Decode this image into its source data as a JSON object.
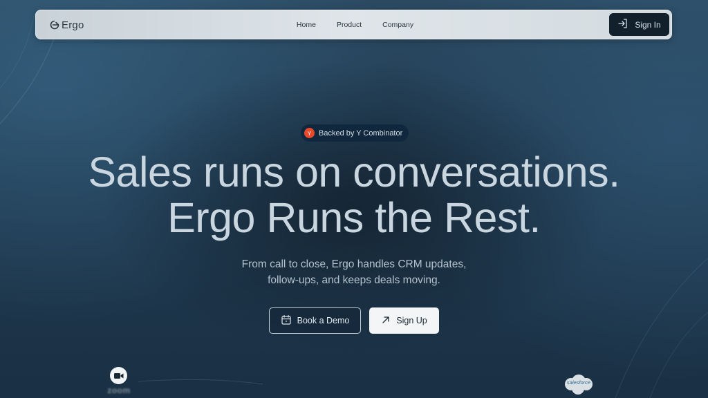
{
  "nav": {
    "logo_text": "Ergo",
    "links": [
      "Home",
      "Product",
      "Company"
    ],
    "signin_label": "Sign In"
  },
  "hero": {
    "badge": {
      "icon_letter": "Y",
      "text": "Backed by Y Combinator"
    },
    "headline_line1": "Sales runs on conversations.",
    "headline_line2": "Ergo Runs the Rest.",
    "subtitle_line1": "From call to close, Ergo handles CRM updates,",
    "subtitle_line2": "follow-ups, and keeps deals moving.",
    "demo_button": "Book a Demo",
    "signup_button": "Sign Up"
  },
  "integrations": {
    "zoom": "zoom",
    "salesforce": "salesforce"
  },
  "colors": {
    "background": "#1c3447",
    "nav_bg": "#dfe5e9",
    "signin_bg": "#12202c",
    "yc_orange": "#e8492a",
    "headline": "#c9d6df"
  },
  "icons": {
    "logo": "ergo-logo-icon",
    "signin": "login-arrow-icon",
    "demo": "calendar-icon",
    "signup": "arrow-up-right-icon"
  }
}
